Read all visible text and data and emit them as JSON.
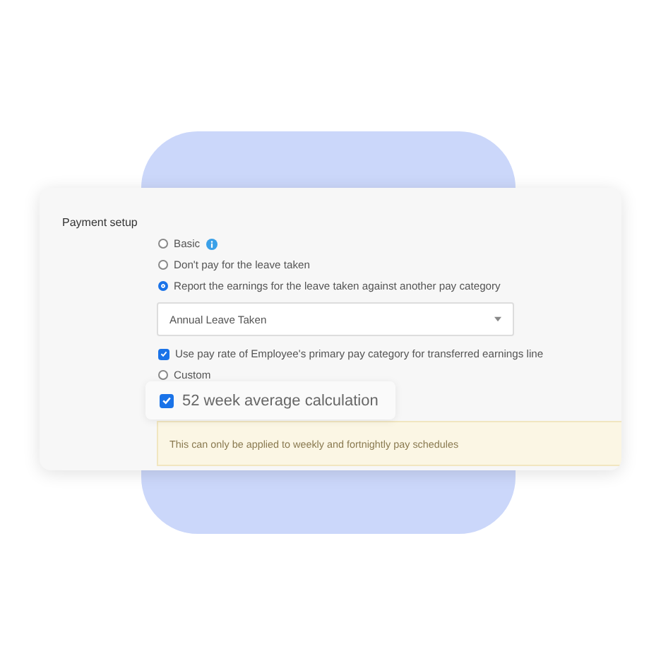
{
  "section_title": "Payment setup",
  "options": [
    {
      "label": "Basic",
      "selected": false,
      "info": true
    },
    {
      "label": "Don't pay for the leave taken",
      "selected": false,
      "info": false
    },
    {
      "label": "Report the earnings for the leave taken against another pay category",
      "selected": true,
      "info": false
    }
  ],
  "pay_category": {
    "value": "Annual Leave Taken"
  },
  "use_pay_rate": {
    "label": "Use pay rate of Employee's primary pay category for transferred earnings line",
    "checked": true
  },
  "custom": {
    "label": "Custom",
    "selected": false
  },
  "average": {
    "label": "52 week average calculation",
    "checked": true
  },
  "notice": "This can only be applied to weekly and fortnightly pay schedules"
}
